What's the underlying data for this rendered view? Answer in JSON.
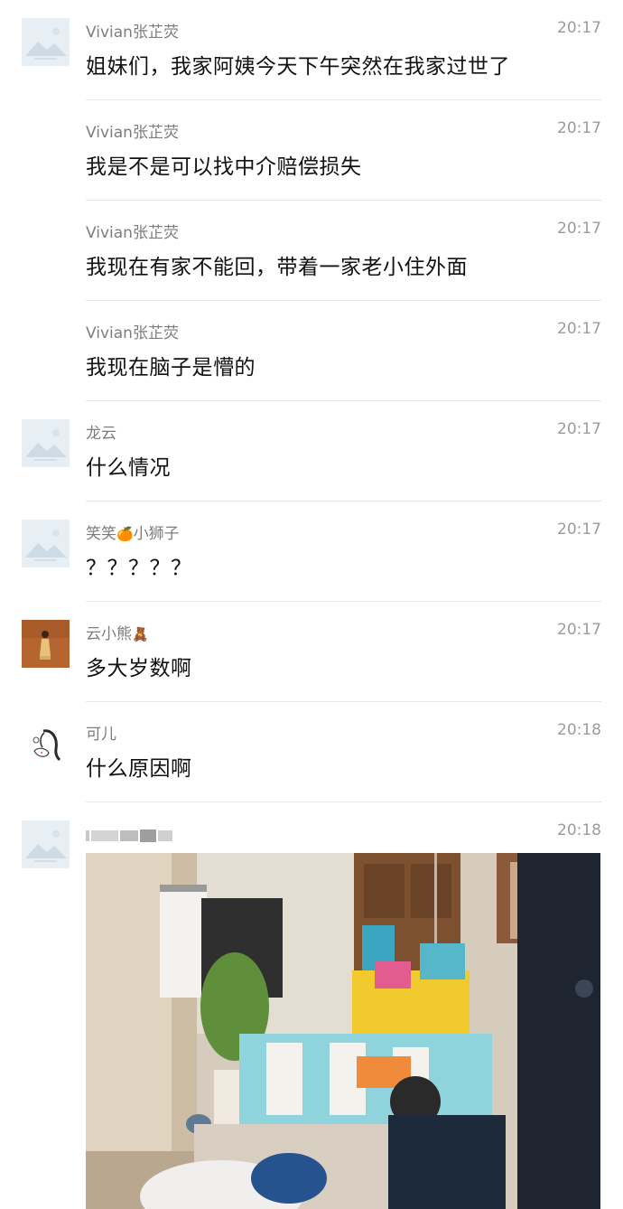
{
  "messages": [
    {
      "name": "Vivian张芷荧",
      "time": "20:17",
      "text": "姐妹们，我家阿姨今天下午突然在我家过世了"
    },
    {
      "name": "Vivian张芷荧",
      "time": "20:17",
      "text": "我是不是可以找中介赔偿损失"
    },
    {
      "name": "Vivian张芷荧",
      "time": "20:17",
      "text": "我现在有家不能回，带着一家老小住外面"
    },
    {
      "name": "Vivian张芷荧",
      "time": "20:17",
      "text": "我现在脑子是懵的"
    },
    {
      "name": "龙云",
      "time": "20:17",
      "text": "什么情况"
    },
    {
      "name": "笑笑",
      "name_suffix": "小狮子",
      "time": "20:17",
      "text": "？？？？？"
    },
    {
      "name": "云小熊",
      "time": "20:17",
      "text": "多大岁数啊"
    },
    {
      "name": "可儿",
      "time": "20:18",
      "text": "什么原因啊"
    },
    {
      "name": "",
      "time": "20:18",
      "text": ""
    }
  ],
  "icons": {
    "placeholder_avatar": "mountain-placeholder-icon",
    "orange_emoji": "🍊",
    "bear_emoji": "🧸"
  },
  "colors": {
    "name": "#7d7d7d",
    "time": "#9b9b9b",
    "text": "#111111",
    "divider": "#e6e6e6",
    "placeholder_bg": "#e7eef3"
  }
}
